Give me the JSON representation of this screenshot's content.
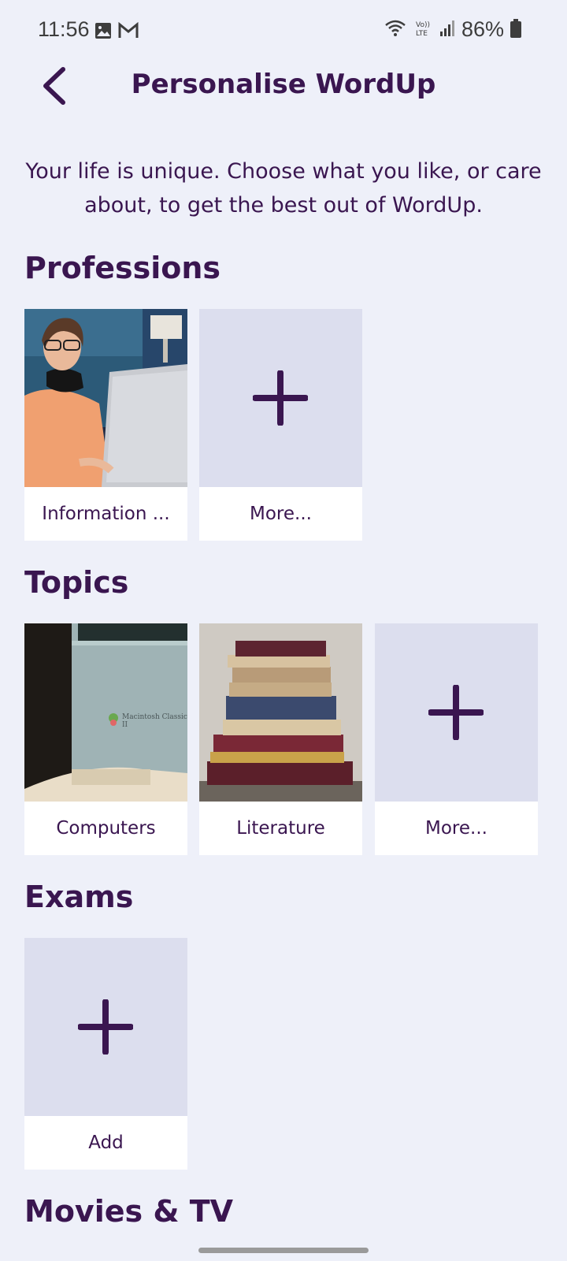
{
  "status_bar": {
    "time": "11:56",
    "battery": "86%",
    "icons": [
      "image-icon",
      "gmail-icon",
      "wifi-icon",
      "volte-icon",
      "signal-icon",
      "battery-icon"
    ]
  },
  "header": {
    "back_icon": "chevron-left-icon",
    "title": "Personalise WordUp"
  },
  "intro": "Your life is unique. Choose what you like, or care about, to get the best out of WordUp.",
  "sections": [
    {
      "title": "Professions",
      "cards": [
        {
          "label": "Information ...",
          "image": "woman-with-laptop"
        },
        {
          "label": "More...",
          "icon": "plus-icon"
        }
      ]
    },
    {
      "title": "Topics",
      "cards": [
        {
          "label": "Computers",
          "image": "macintosh-classic-computer",
          "image_text": "Macintosh Classic II"
        },
        {
          "label": "Literature",
          "image": "stack-of-old-books"
        },
        {
          "label": "More...",
          "icon": "plus-icon"
        }
      ]
    },
    {
      "title": "Exams",
      "cards": [
        {
          "label": "Add",
          "icon": "plus-icon"
        }
      ]
    },
    {
      "title": "Movies & TV",
      "cards": []
    }
  ],
  "colors": {
    "background": "#eef0f9",
    "accent": "#3a1650",
    "add_tile": "#dcdeee",
    "card": "#ffffff"
  }
}
